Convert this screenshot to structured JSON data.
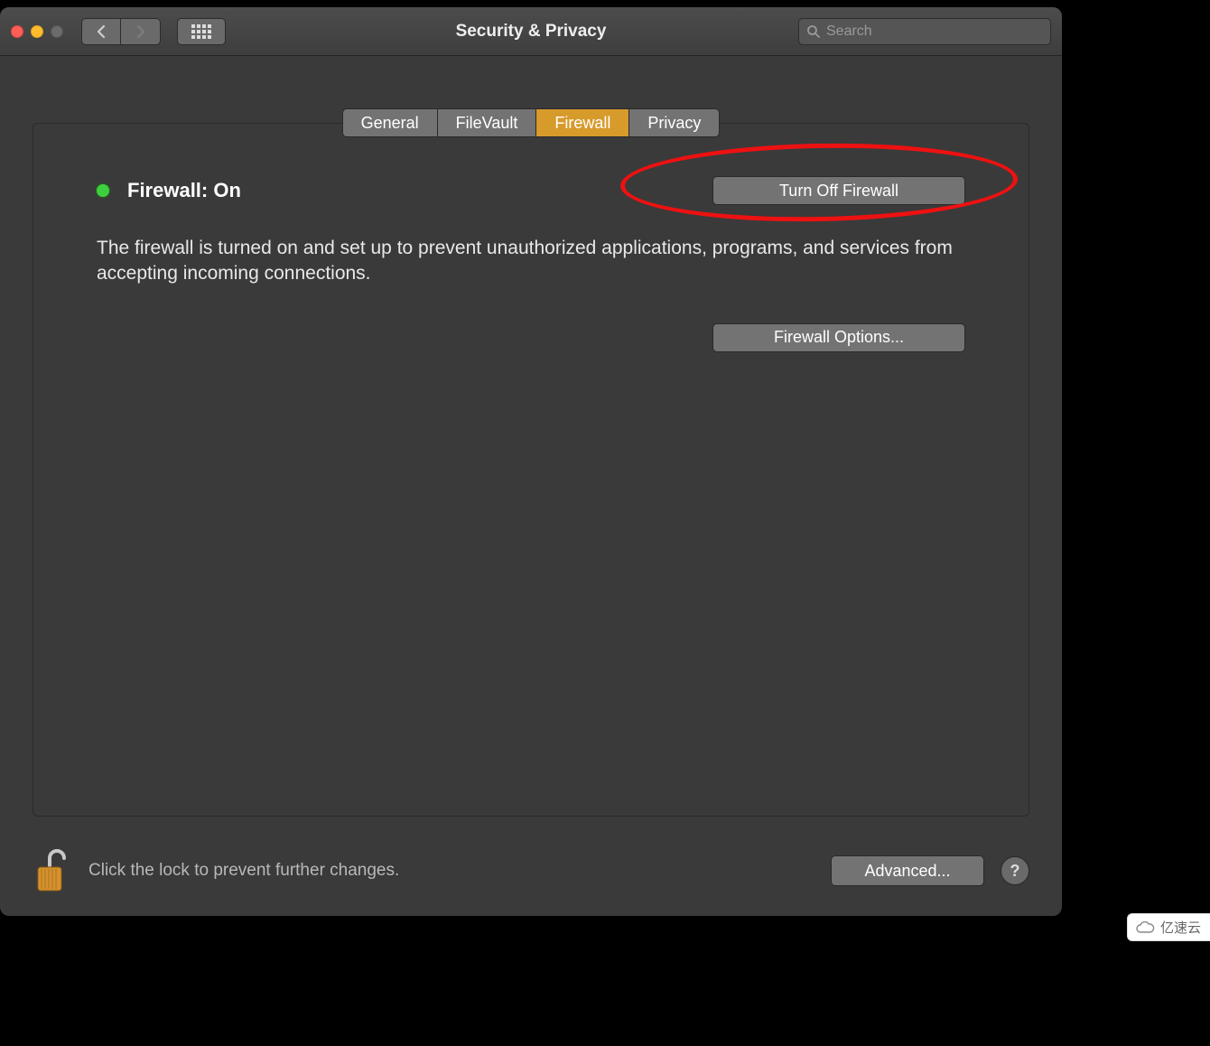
{
  "window": {
    "title": "Security & Privacy",
    "search_placeholder": "Search"
  },
  "tabs": [
    {
      "label": "General",
      "active": false
    },
    {
      "label": "FileVault",
      "active": false
    },
    {
      "label": "Firewall",
      "active": true
    },
    {
      "label": "Privacy",
      "active": false
    }
  ],
  "firewall": {
    "status_label": "Firewall: On",
    "status_color": "#3ecf3e",
    "turn_off_label": "Turn Off Firewall",
    "description": "The firewall is turned on and set up to prevent unauthorized applications, programs, and services from accepting incoming connections.",
    "options_label": "Firewall Options..."
  },
  "footer": {
    "lock_text": "Click the lock to prevent further changes.",
    "advanced_label": "Advanced...",
    "help_label": "?"
  },
  "watermark": {
    "text": "亿速云"
  },
  "annotation": {
    "highlight": "turn-off-firewall-button"
  }
}
